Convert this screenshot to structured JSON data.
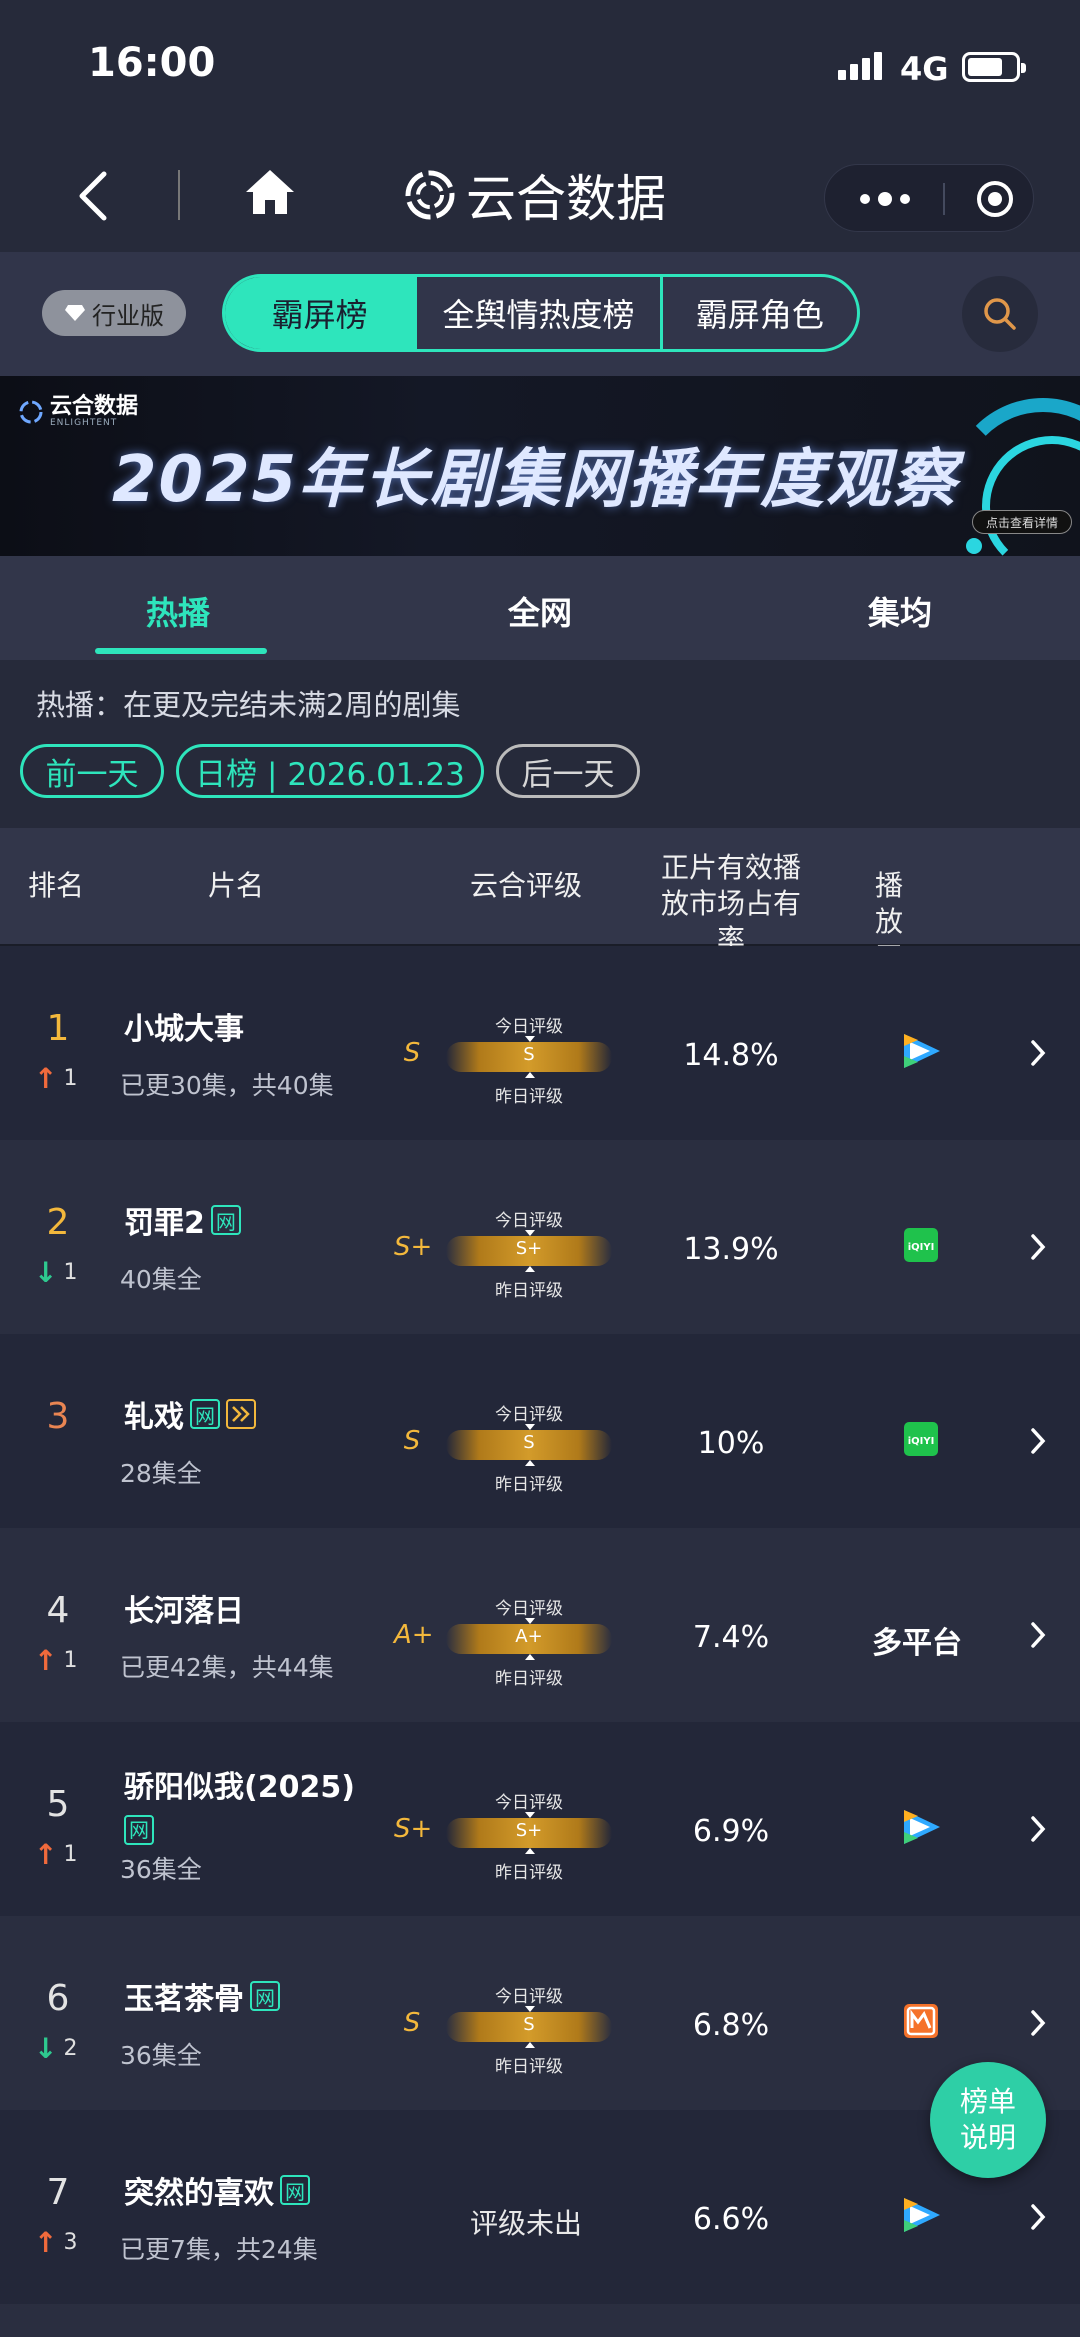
{
  "status_bar": {
    "time": "16:00",
    "network": "4G"
  },
  "nav": {
    "title": "云合数据"
  },
  "top_bar": {
    "edition": "行业版",
    "segments": [
      {
        "label": "霸屏榜",
        "active": true
      },
      {
        "label": "全舆情热度榜",
        "active": false
      },
      {
        "label": "霸屏角色",
        "active": false
      }
    ]
  },
  "banner": {
    "brand": "云合数据",
    "brand_en": "ENLIGHTENT",
    "headline": "2025年长剧集网播年度观察",
    "detail_button": "点击查看详情"
  },
  "tabs": [
    {
      "label": "热播",
      "active": true
    },
    {
      "label": "全网",
      "active": false
    },
    {
      "label": "集均",
      "active": false
    }
  ],
  "description": "热播：在更及完结未满2周的剧集",
  "date_nav": {
    "prev": "前一天",
    "current": "日榜 | 2026.01.23",
    "next": "后一天"
  },
  "table": {
    "headers": {
      "rank": "排名",
      "name": "片名",
      "grade": "云合评级",
      "share": "正片有效播放市场占有率",
      "platform": "播放平台"
    },
    "grade_today_label": "今日评级",
    "grade_yesterday_label": "昨日评级",
    "rows": [
      {
        "rank": "1",
        "change_dir": "up",
        "change": "1",
        "title": "小城大事",
        "tags": [],
        "episodes": "已更30集，共40集",
        "grade": "S",
        "grade_bar": "S",
        "share": "14.8%",
        "platform": "tencent-video-icon"
      },
      {
        "rank": "2",
        "change_dir": "down",
        "change": "1",
        "title": "罚罪2",
        "tags": [
          "网"
        ],
        "episodes": "40集全",
        "grade": "S+",
        "grade_bar": "S+",
        "share": "13.9%",
        "platform": "iqiyi-icon"
      },
      {
        "rank": "3",
        "change_dir": "",
        "change": "",
        "title": "轧戏",
        "tags": [
          "网",
          "play"
        ],
        "episodes": "28集全",
        "grade": "S",
        "grade_bar": "S",
        "share": "10%",
        "platform": "iqiyi-icon"
      },
      {
        "rank": "4",
        "change_dir": "up",
        "change": "1",
        "title": "长河落日",
        "tags": [],
        "episodes": "已更42集，共44集",
        "grade": "A+",
        "grade_bar": "A+",
        "share": "7.4%",
        "platform_text": "多平台"
      },
      {
        "rank": "5",
        "change_dir": "up",
        "change": "1",
        "title": "骄阳似我(2025)",
        "tags": [
          "网"
        ],
        "episodes": "36集全",
        "grade": "S+",
        "grade_bar": "S+",
        "share": "6.9%",
        "platform": "tencent-video-icon"
      },
      {
        "rank": "6",
        "change_dir": "down",
        "change": "2",
        "title": "玉茗茶骨",
        "tags": [
          "网"
        ],
        "episodes": "36集全",
        "grade": "S",
        "grade_bar": "S",
        "share": "6.8%",
        "platform": "mango-tv-icon"
      },
      {
        "rank": "7",
        "change_dir": "up",
        "change": "3",
        "title": "突然的喜欢",
        "tags": [
          "网"
        ],
        "episodes": "已更7集，共24集",
        "grade_text": "评级未出",
        "share": "6.6%",
        "platform": "tencent-video-icon"
      }
    ]
  },
  "fab": {
    "line1": "榜单",
    "line2": "说明"
  },
  "colors": {
    "accent": "#2ee5bc",
    "gold": "#f3b83c",
    "up": "#f06a3c",
    "down": "#2ec98f"
  }
}
